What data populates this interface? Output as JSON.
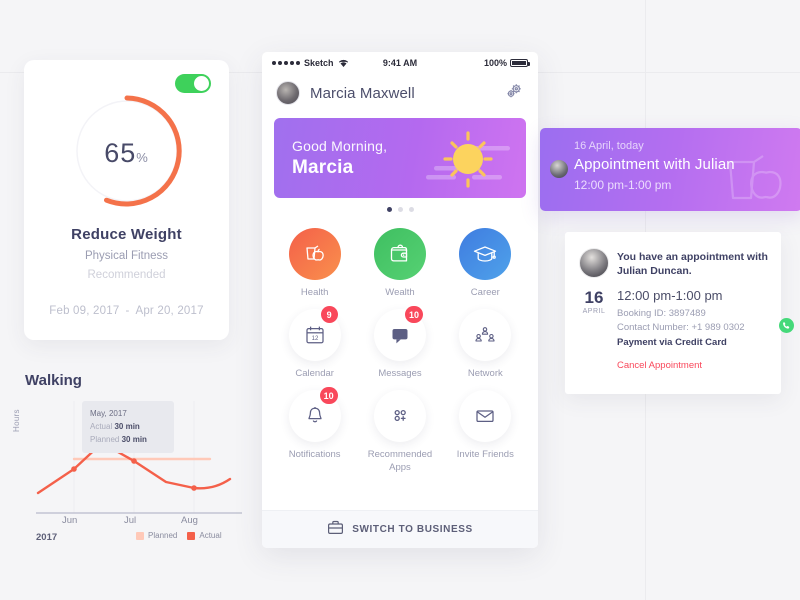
{
  "background": {
    "color": "#f5f5f7",
    "grid_color": "#ebebee"
  },
  "goal_card": {
    "toggle": {
      "name": "goal-toggle",
      "state": "on",
      "color": "#3ed15b"
    },
    "progress": {
      "value": "65",
      "unit": "%",
      "ring_color": "#f4724a",
      "track_color": "#f2f2f6"
    },
    "title": "Reduce Weight",
    "subtitle": "Physical Fitness",
    "recommended": "Recommended",
    "date_start": "Feb 09, 2017",
    "date_separator": "-",
    "date_end": "Apr 20, 2017"
  },
  "walking_chart": {
    "title": "Walking",
    "year": "2017",
    "y_axis_label": "Hours",
    "tooltip": {
      "month": "May, 2017",
      "actual_label": "Actual",
      "actual_value": "30 min",
      "planned_label": "Planned",
      "planned_value": "30 min"
    },
    "legend": [
      {
        "label": "Planned",
        "color": "#ffc9b8"
      },
      {
        "label": "Actual",
        "color": "#f4604a"
      }
    ]
  },
  "chart_data": {
    "type": "line",
    "title": "Walking",
    "xlabel": "2017",
    "ylabel": "Hours",
    "x": [
      "Jun",
      "Jul",
      "Aug"
    ],
    "tick_labels": [
      "Jun",
      "Jul",
      "Aug"
    ],
    "grid": true,
    "legend_position": "bottom-right",
    "series": [
      {
        "name": "Actual",
        "color": "#f4604a",
        "points": [
          {
            "x": 0.0,
            "y": 1.15
          },
          {
            "x": 0.55,
            "y": 2.25
          },
          {
            "x": 1.0,
            "y": 3.1
          },
          {
            "x": 1.55,
            "y": 2.85
          },
          {
            "x": 2.0,
            "y": 2.1
          },
          {
            "x": 2.6,
            "y": 1.45
          },
          {
            "x": 3.0,
            "y": 1.42
          },
          {
            "x": 3.5,
            "y": 1.75
          }
        ],
        "markers": [
          {
            "x": 0.55,
            "y": 2.25
          },
          {
            "x": 1.55,
            "y": 2.85
          },
          {
            "x": 3.0,
            "y": 1.42
          }
        ]
      },
      {
        "name": "Planned",
        "color": "#ffc9b8",
        "constant_value": 2.05,
        "points": [
          {
            "x": 0.55,
            "y": 2.05
          },
          {
            "x": 3.2,
            "y": 2.05
          }
        ]
      }
    ]
  },
  "phone": {
    "statusbar": {
      "carrier": "Sketch",
      "wifi_icon": "wifi-icon",
      "time": "9:41 AM",
      "battery_percent": "100%",
      "battery_icon": "battery-full-icon"
    },
    "nav": {
      "avatar": "user-avatar",
      "user_name": "Marcia Maxwell",
      "settings_icon": "gears-icon"
    },
    "hero": {
      "greeting": "Good Morning,",
      "name": "Marcia",
      "illustration": "sun-icon",
      "gradient_from": "#a070ee",
      "gradient_to": "#cf74f0",
      "pager": {
        "total": 3,
        "active": 1
      }
    },
    "apps": [
      {
        "label": "Health",
        "icon": "juice-apple-icon",
        "style": "filled",
        "gradient_from": "#f4604a",
        "gradient_to": "#f88a4a",
        "badge": ""
      },
      {
        "label": "Wealth",
        "icon": "wallet-icon",
        "style": "filled",
        "gradient_from": "#3fbf61",
        "gradient_to": "#52ce6e",
        "badge": ""
      },
      {
        "label": "Career",
        "icon": "graduation-cap-icon",
        "style": "filled",
        "gradient_from": "#3f7ce0",
        "gradient_to": "#4b9ae8",
        "badge": ""
      },
      {
        "label": "Calendar",
        "icon": "calendar-icon",
        "style": "plain",
        "badge": "9"
      },
      {
        "label": "Messages",
        "icon": "chat-bubble-icon",
        "style": "plain",
        "badge": "10"
      },
      {
        "label": "Network",
        "icon": "network-people-icon",
        "style": "plain",
        "badge": ""
      },
      {
        "label": "Notifications",
        "icon": "bell-icon",
        "style": "plain",
        "badge": "10"
      },
      {
        "label": "Recommended Apps",
        "icon": "apps-plus-icon",
        "style": "plain",
        "badge": ""
      },
      {
        "label": "Invite Friends",
        "icon": "envelope-icon",
        "style": "plain",
        "badge": ""
      }
    ],
    "switch_bar": {
      "icon": "briefcase-icon",
      "label": "SWITCH TO BUSINESS"
    }
  },
  "appointment_banner": {
    "date": "16 April, today",
    "title": "Appointment with Julian",
    "time": "12:00 pm-1:00 pm",
    "avatar": "julian-avatar",
    "watermark_icon": "juice-apple-icon"
  },
  "appointment_detail": {
    "avatar": "julian-duncan-avatar",
    "headline": "You have an appointment with Julian Duncan.",
    "day": "16",
    "month": "APRIL",
    "time": "12:00 pm-1:00 pm",
    "booking_id": "Booking ID: 3897489",
    "contact_number": "Contact Number: +1 989 0302",
    "call_icon": "phone-icon",
    "payment": "Payment via Credit Card",
    "cancel_label": "Cancel Appointment",
    "cancel_color": "#f9485b"
  }
}
